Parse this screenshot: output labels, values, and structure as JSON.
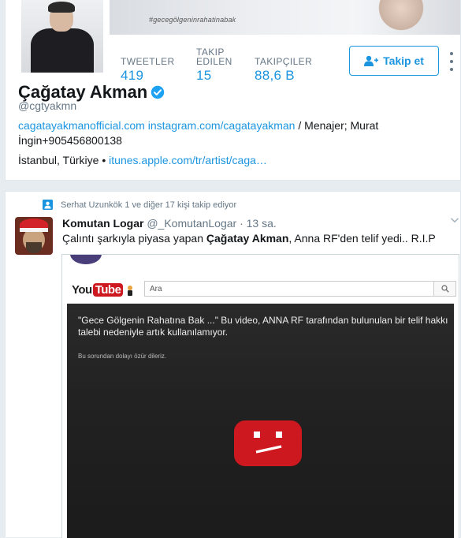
{
  "profile": {
    "banner_hashtag": "#gecegölgeninrahatinabak",
    "display_name": "Çağatay Akman",
    "screen_name": "@cgtyakmn",
    "stats": {
      "tweets": {
        "label": "TWEETLER",
        "value": "419"
      },
      "following": {
        "label_line1": "TAKIP",
        "label_line2": "EDILEN",
        "value": "15"
      },
      "followers": {
        "label": "TAKIPÇILER",
        "value": "88,6 B"
      }
    },
    "follow_label": "Takip et",
    "bio": {
      "link1": "cagatayakmanofficial.com",
      "link2": "instagram.com/cagatayakman",
      "rest": " / Menajer; Murat İngin+905456800138"
    },
    "location": "İstanbul, Türkiye",
    "separator": " • ",
    "website": "itunes.apple.com/tr/artist/caga…"
  },
  "tweet": {
    "context": "Serhat Uzunkök 1 ve diğer 17 kişi takip ediyor",
    "author": "Komutan Logar",
    "handle": "@_KomutanLogar",
    "dot": " · ",
    "time": "13 sa.",
    "text_before": "Çalıntı şarkıyla piyasa yapan ",
    "text_bold": "Çağatay Akman",
    "text_after": ", Anna RF'den telif yedi.. R.I.P"
  },
  "youtube": {
    "logo_you": "You",
    "logo_tube": "Tube",
    "search_placeholder": "Ara",
    "error_message": "\"Gece Gölgenin Rahatına Bak ...\" Bu video, ANNA RF tarafından bulunulan bir telif hakkı talebi nedeniyle artık kullanılamıyor.",
    "sorry_text": "Bu sorundan dolayı özür dileriz."
  },
  "colors": {
    "link_blue": "#1b95e0",
    "muted_gray": "#657786",
    "youtube_red": "#cc181e"
  }
}
